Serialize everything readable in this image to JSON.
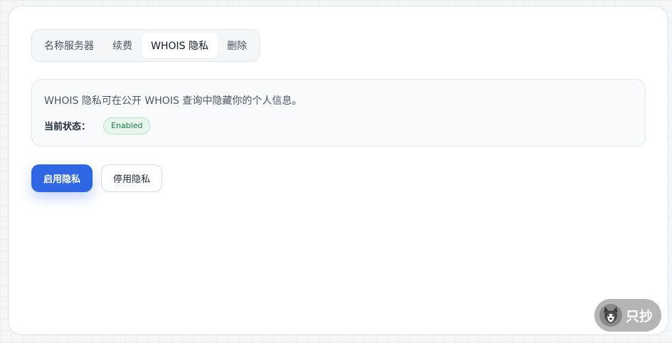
{
  "tabs": [
    {
      "label": "名称服务器",
      "active": false
    },
    {
      "label": "续费",
      "active": false
    },
    {
      "label": "WHOIS 隐私",
      "active": true
    },
    {
      "label": "删除",
      "active": false
    }
  ],
  "privacy_panel": {
    "description": "WHOIS 隐私可在公开 WHOIS 查询中隐藏你的个人信息。",
    "status_label": "当前状态：",
    "status_value": "Enabled"
  },
  "actions": {
    "enable_label": "启用隐私",
    "disable_label": "停用隐私"
  },
  "watermark": {
    "text": "只抄",
    "icon": "husky-dog-icon"
  },
  "colors": {
    "primary": "#2f66e4",
    "status_success_text": "#15803d",
    "status_success_bg": "#e8f7ee",
    "card_bg": "#ffffff",
    "panel_bg": "#f8fafc"
  }
}
